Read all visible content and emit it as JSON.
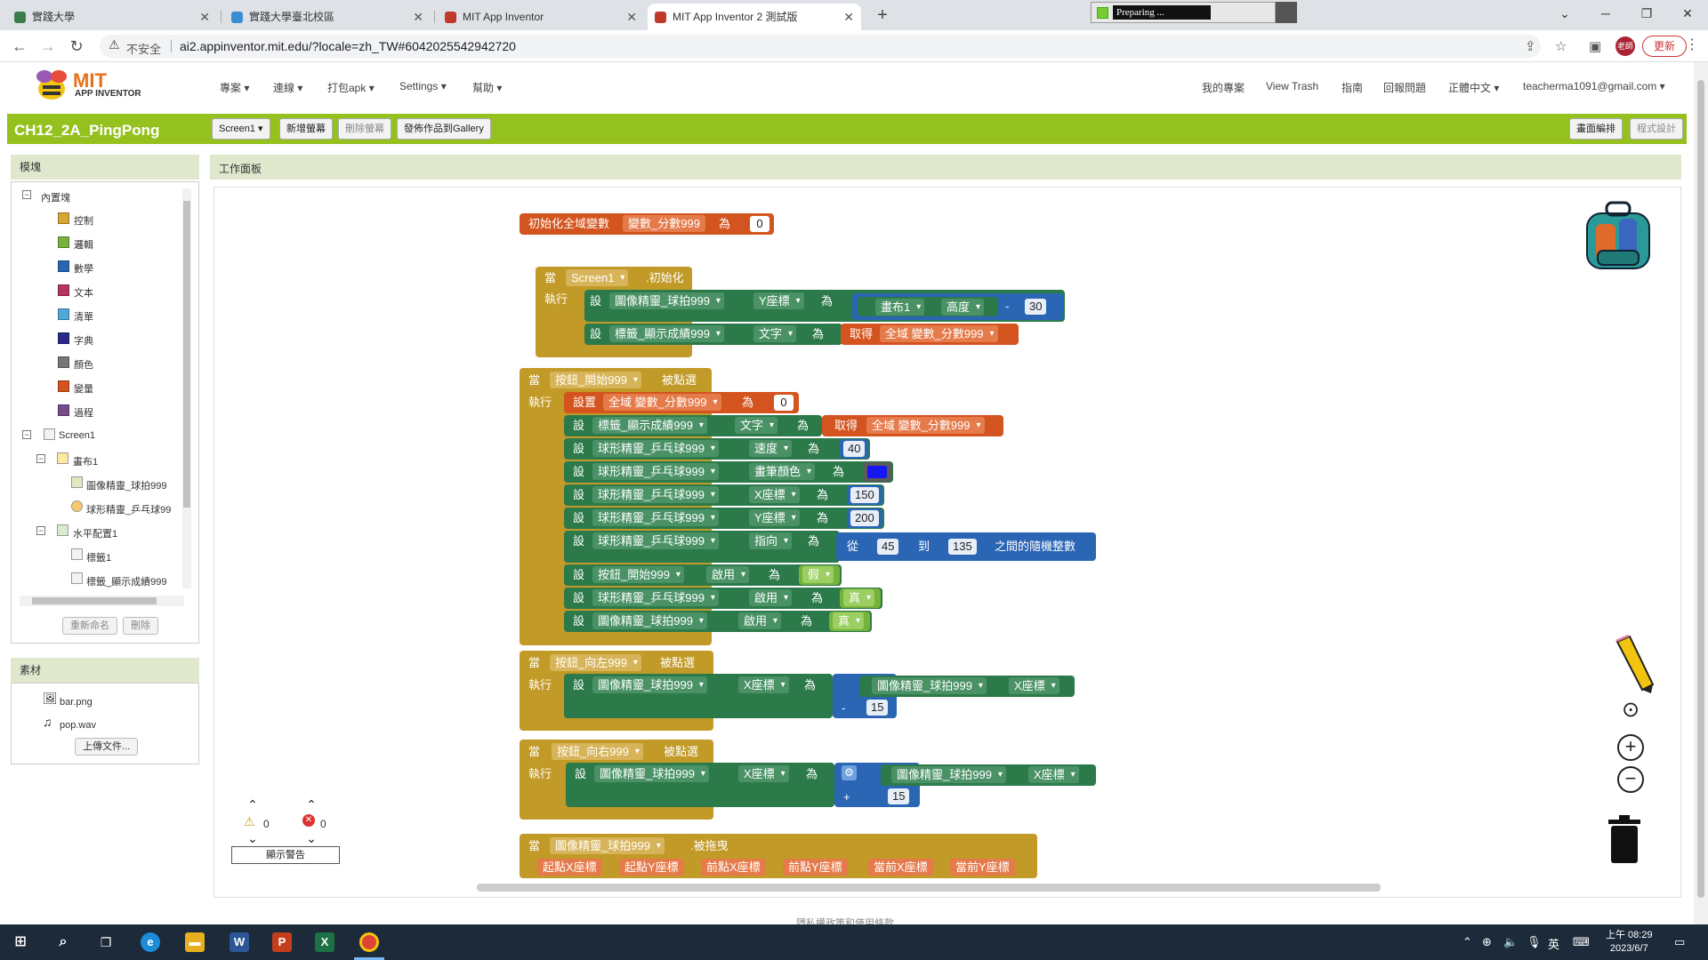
{
  "browser": {
    "tabs": [
      {
        "title": "實踐大學",
        "color": "#3a7d4a"
      },
      {
        "title": "實踐大學臺北校區",
        "color": "#3a8dd1"
      },
      {
        "title": "MIT App Inventor",
        "color": "#c0392b"
      },
      {
        "title": "MIT App Inventor 2 測試版",
        "color": "#c0392b"
      }
    ],
    "new_tab": "+",
    "preparing_text": "Preparing ...",
    "insecure_label": "不安全",
    "url": "ai2.appinventor.mit.edu/?locale=zh_TW#6042025542942720",
    "profile_label": "老師",
    "update_label": "更新"
  },
  "app": {
    "logo_mit": "MIT",
    "logo_sub": "APP INVENTOR",
    "menu": [
      "專案",
      "連線",
      "打包apk",
      "Settings",
      "幫助"
    ],
    "right_menu": [
      "我的專案",
      "View Trash",
      "指南",
      "回報問題",
      "正體中文",
      "teacherma1091@gmail.com"
    ]
  },
  "project": {
    "name": "CH12_2A_PingPong",
    "screen_select": "Screen1",
    "add_screen": "新增螢幕",
    "delete_screen": "刪除螢幕",
    "publish": "發佈作品到Gallery",
    "blocks_editor": "畫面編排",
    "designer": "程式設計"
  },
  "blocks_panel": {
    "title": "模塊",
    "builtin": "內置塊",
    "categories": [
      {
        "label": "控制",
        "color": "#d7a536"
      },
      {
        "label": "邏輯",
        "color": "#77b23c"
      },
      {
        "label": "數學",
        "color": "#2b66b5"
      },
      {
        "label": "文本",
        "color": "#b7355c"
      },
      {
        "label": "清單",
        "color": "#4fa8d5"
      },
      {
        "label": "字典",
        "color": "#2a2a8a"
      },
      {
        "label": "顏色",
        "color": "#777777"
      },
      {
        "label": "變量",
        "color": "#d3541e"
      },
      {
        "label": "過程",
        "color": "#7a4a8a"
      }
    ],
    "screen": "Screen1",
    "canvas": "畫布1",
    "sprite_paddle": "圖像精靈_球拍999",
    "sprite_ball": "球形精靈_乒乓球99",
    "hlayout": "水平配置1",
    "label1": "標籤1",
    "label_score": "標籤_顯示成績999",
    "rename": "重新命名",
    "delete": "刪除"
  },
  "media_panel": {
    "title": "素材",
    "files": [
      "bar.png",
      "pop.wav"
    ],
    "upload": "上傳文件..."
  },
  "workspace": {
    "title": "工作面板",
    "warnings": "0",
    "errors": "0",
    "show_warnings": "顯示警告",
    "footer": "隱私權政策和使用條款"
  },
  "blocks": {
    "init_global": "初始化全域變數",
    "var_name": "變數_分數999",
    "as": "為",
    "zero": "0",
    "when": "當",
    "do": "執行",
    "set": "設",
    "screen1": "Screen1",
    "initialize": ".初始化",
    "paddle": "圖像精靈_球拍999",
    "y_coord": "Y座標",
    "x_coord": "X座標",
    "canvas1": "畫布1",
    "height": "高度",
    "minus": "-",
    "plus": "+",
    "thirty": "30",
    "score_label": "標籤_顯示成績999",
    "text": "文字",
    "get": "取得",
    "global_score": "全域 變數_分數999",
    "start_btn": "按鈕_開始999",
    "clicked": "被點選",
    "set_var": "設置",
    "ball": "球形精靈_乒乓球999",
    "speed": "速度",
    "forty": "40",
    "paint_color": "畫筆顏色",
    "v150": "150",
    "v200": "200",
    "heading": "指向",
    "from": "從",
    "v45": "45",
    "to": "到",
    "v135": "135",
    "random_int": "之間的隨機整數",
    "enabled": "啟用",
    "false": "假",
    "true": "真",
    "left_btn": "按鈕_向左999",
    "right_btn": "按鈕_向右999",
    "fifteen": "15",
    "dragged": ".被拖曳",
    "drag_params": [
      "起點X座標",
      "起點Y座標",
      "前點X座標",
      "前點Y座標",
      "當前X座標",
      "當前Y座標"
    ]
  },
  "taskbar": {
    "ime": "英",
    "time": "上午 08:29",
    "date": "2023/6/7"
  }
}
